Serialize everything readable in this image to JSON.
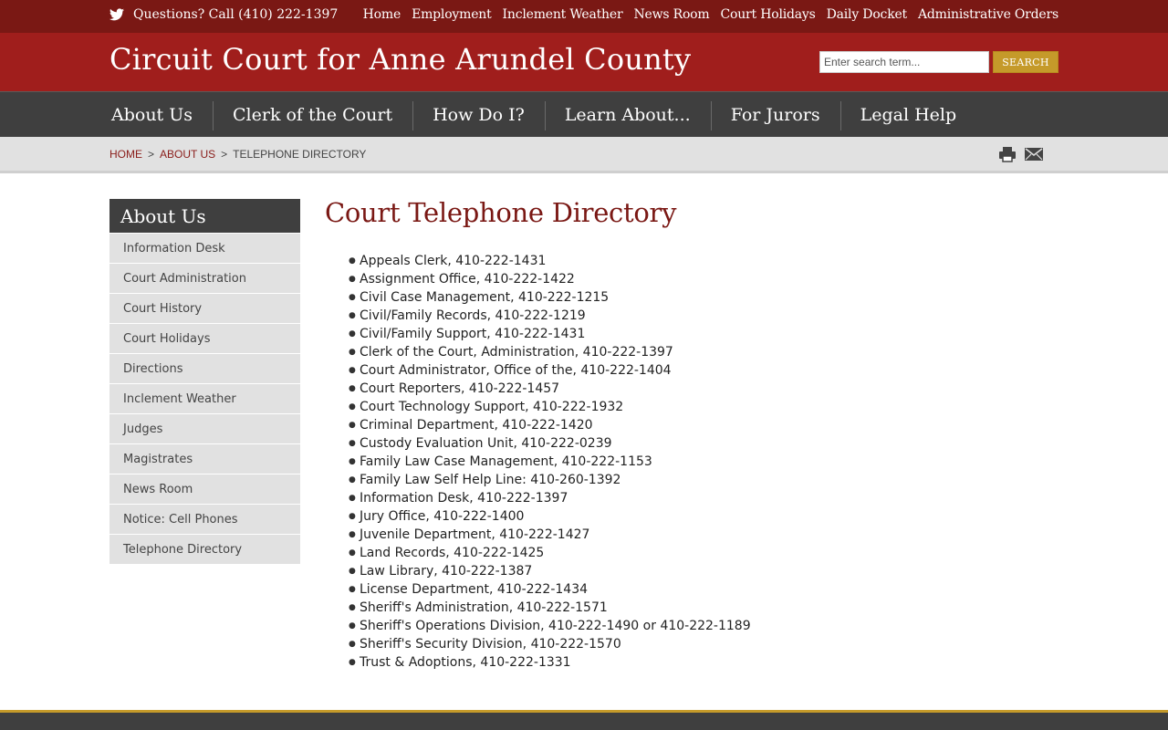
{
  "topbar": {
    "phone": "Questions? Call (410) 222-1397",
    "links": [
      "Home",
      "Employment",
      "Inclement Weather",
      "News Room",
      "Court Holidays",
      "Daily Docket",
      "Administrative Orders"
    ]
  },
  "header": {
    "title": "Circuit Court for Anne Arundel County",
    "search_placeholder": "Enter search term...",
    "search_label": "SEARCH"
  },
  "nav": [
    "About Us",
    "Clerk of the Court",
    "How Do I?",
    "Learn About...",
    "For Jurors",
    "Legal Help"
  ],
  "breadcrumb": {
    "home": "HOME",
    "sep": ">",
    "section": "ABOUT US",
    "current": "TELEPHONE DIRECTORY"
  },
  "tools": {
    "print_icon": "print-icon",
    "email_icon": "email-icon"
  },
  "sidebar": {
    "heading": "About Us",
    "items": [
      "Information Desk",
      "Court Administration",
      "Court History",
      "Court Holidays",
      "Directions",
      "Inclement Weather",
      "Judges",
      "Magistrates",
      "News Room",
      "Notice: Cell Phones",
      "Telephone Directory"
    ]
  },
  "main": {
    "title": "Court Telephone Directory",
    "entries": [
      "Appeals Clerk, 410-222-1431",
      "Assignment Office, 410-222-1422",
      "Civil Case Management, 410-222-1215",
      "Civil/Family Records, 410-222-1219",
      "Civil/Family Support, 410-222-1431",
      "Clerk of the Court, Administration, 410-222-1397",
      "Court Administrator, Office of the, 410-222-1404",
      "Court Reporters, 410-222-1457",
      "Court Technology Support, 410-222-1932",
      "Criminal Department, 410-222-1420",
      "Custody Evaluation Unit, 410-222-0239",
      "Family Law Case Management, 410-222-1153",
      "Family Law Self Help Line: 410-260-1392",
      "Information Desk, 410-222-1397",
      "Jury Office, 410-222-1400",
      "Juvenile Department, 410-222-1427",
      "Land Records, 410-222-1425",
      "Law Library, 410-222-1387",
      "License Department, 410-222-1434",
      "Sheriff's Administration, 410-222-1571",
      "Sheriff's Operations Division, 410-222-1490 or 410-222-1189",
      "Sheriff's Security Division, 410-222-1570",
      "Trust & Adoptions, 410-222-1331"
    ]
  },
  "colors": {
    "top_bar": "#7a1814",
    "header": "#a01e1c",
    "nav": "#3f3f3f",
    "accent_gold": "#c59a2a",
    "title_red": "#7a1814"
  }
}
